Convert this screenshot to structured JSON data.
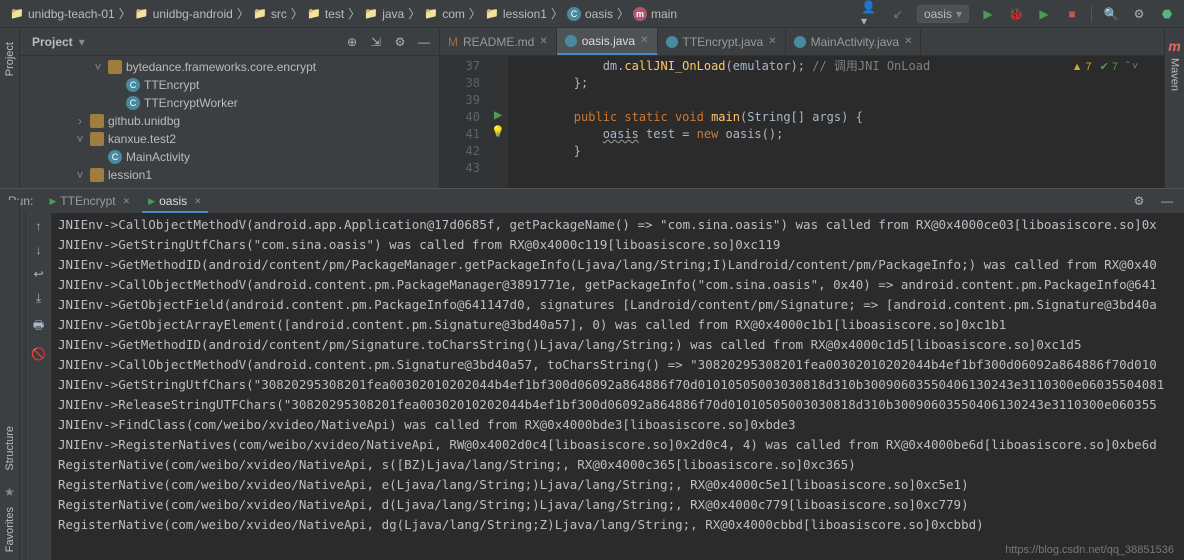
{
  "breadcrumb": {
    "items": [
      {
        "label": "unidbg-teach-01",
        "kind": "folder"
      },
      {
        "label": "unidbg-android",
        "kind": "folder"
      },
      {
        "label": "src",
        "kind": "folder"
      },
      {
        "label": "test",
        "kind": "folder"
      },
      {
        "label": "java",
        "kind": "folder"
      },
      {
        "label": "com",
        "kind": "folder"
      },
      {
        "label": "lession1",
        "kind": "folder"
      },
      {
        "label": "oasis",
        "kind": "class"
      },
      {
        "label": "main",
        "kind": "method"
      }
    ]
  },
  "runConfig": {
    "selected": "oasis"
  },
  "projectPanel": {
    "title": "Project",
    "tree": [
      {
        "indent": 4,
        "kind": "package",
        "expanded": true,
        "label": "bytedance.frameworks.core.encrypt"
      },
      {
        "indent": 5,
        "kind": "class",
        "label": "TTEncrypt"
      },
      {
        "indent": 5,
        "kind": "class",
        "label": "TTEncryptWorker"
      },
      {
        "indent": 3,
        "kind": "package",
        "expanded": false,
        "label": "github.unidbg"
      },
      {
        "indent": 3,
        "kind": "package",
        "expanded": true,
        "label": "kanxue.test2"
      },
      {
        "indent": 4,
        "kind": "class",
        "label": "MainActivity"
      },
      {
        "indent": 3,
        "kind": "package",
        "expanded": true,
        "label": "lession1"
      }
    ]
  },
  "leftRail": {
    "project": "Project"
  },
  "leftBottomRail": {
    "favorites": "Favorites",
    "structure": "Structure"
  },
  "rightRail": {
    "maven": "Maven"
  },
  "editor": {
    "tabs": [
      {
        "label": "README.md",
        "active": false,
        "kind": "md"
      },
      {
        "label": "oasis.java",
        "active": true,
        "kind": "java"
      },
      {
        "label": "TTEncrypt.java",
        "active": false,
        "kind": "java"
      },
      {
        "label": "MainActivity.java",
        "active": false,
        "kind": "java"
      }
    ],
    "warnCount": "7",
    "typoCount": "7",
    "lines": [
      {
        "n": "37",
        "html": "            dm.<span class='fn'>callJNI_OnLoad</span>(<span class='ident'>emulator</span>); <span class='cmt'>// 调用JNI OnLoad</span>"
      },
      {
        "n": "38",
        "html": "        };"
      },
      {
        "n": "39",
        "html": ""
      },
      {
        "n": "40",
        "html": "        <span class='kw'>public static void</span> <span class='fn'>main</span>(String[] args) {",
        "runmark": true
      },
      {
        "n": "41",
        "html": "            <span class='err'>oasis</span> test = <span class='kw'>new</span> oasis();",
        "bulb": true
      },
      {
        "n": "42",
        "html": "        }"
      },
      {
        "n": "43",
        "html": ""
      }
    ]
  },
  "run": {
    "label": "Run:",
    "tabs": [
      {
        "label": "TTEncrypt",
        "active": false
      },
      {
        "label": "oasis",
        "active": true
      }
    ],
    "console": [
      "JNIEnv->CallObjectMethodV(android.app.Application@17d0685f, getPackageName() => \"com.sina.oasis\") was called from RX@0x4000ce03[liboasiscore.so]0x",
      "JNIEnv->GetStringUtfChars(\"com.sina.oasis\") was called from RX@0x4000c119[liboasiscore.so]0xc119",
      "JNIEnv->GetMethodID(android/content/pm/PackageManager.getPackageInfo(Ljava/lang/String;I)Landroid/content/pm/PackageInfo;) was called from RX@0x40",
      "JNIEnv->CallObjectMethodV(android.content.pm.PackageManager@3891771e, getPackageInfo(\"com.sina.oasis\", 0x40) => android.content.pm.PackageInfo@641",
      "JNIEnv->GetObjectField(android.content.pm.PackageInfo@641147d0, signatures [Landroid/content/pm/Signature; => [android.content.pm.Signature@3bd40a",
      "JNIEnv->GetObjectArrayElement([android.content.pm.Signature@3bd40a57], 0) was called from RX@0x4000c1b1[liboasiscore.so]0xc1b1",
      "JNIEnv->GetMethodID(android/content/pm/Signature.toCharsString()Ljava/lang/String;) was called from RX@0x4000c1d5[liboasiscore.so]0xc1d5",
      "JNIEnv->CallObjectMethodV(android.content.pm.Signature@3bd40a57, toCharsString() => \"30820295308201fea00302010202044b4ef1bf300d06092a864886f70d010",
      "JNIEnv->GetStringUtfChars(\"30820295308201fea00302010202044b4ef1bf300d06092a864886f70d01010505003030818d310b30090603550406130243e3110300e06035504081",
      "JNIEnv->ReleaseStringUTFChars(\"30820295308201fea00302010202044b4ef1bf300d06092a864886f70d01010505003030818d310b30090603550406130243e3110300e060355",
      "JNIEnv->FindClass(com/weibo/xvideo/NativeApi) was called from RX@0x4000bde3[liboasiscore.so]0xbde3",
      "JNIEnv->RegisterNatives(com/weibo/xvideo/NativeApi, RW@0x4002d0c4[liboasiscore.so]0x2d0c4, 4) was called from RX@0x4000be6d[liboasiscore.so]0xbe6d",
      "RegisterNative(com/weibo/xvideo/NativeApi, s([BZ)Ljava/lang/String;, RX@0x4000c365[liboasiscore.so]0xc365)",
      "RegisterNative(com/weibo/xvideo/NativeApi, e(Ljava/lang/String;)Ljava/lang/String;, RX@0x4000c5e1[liboasiscore.so]0xc5e1)",
      "RegisterNative(com/weibo/xvideo/NativeApi, d(Ljava/lang/String;)Ljava/lang/String;, RX@0x4000c779[liboasiscore.so]0xc779)",
      "RegisterNative(com/weibo/xvideo/NativeApi, dg(Ljava/lang/String;Z)Ljava/lang/String;, RX@0x4000cbbd[liboasiscore.so]0xcbbd)"
    ]
  },
  "watermark": "https://blog.csdn.net/qq_38851536"
}
